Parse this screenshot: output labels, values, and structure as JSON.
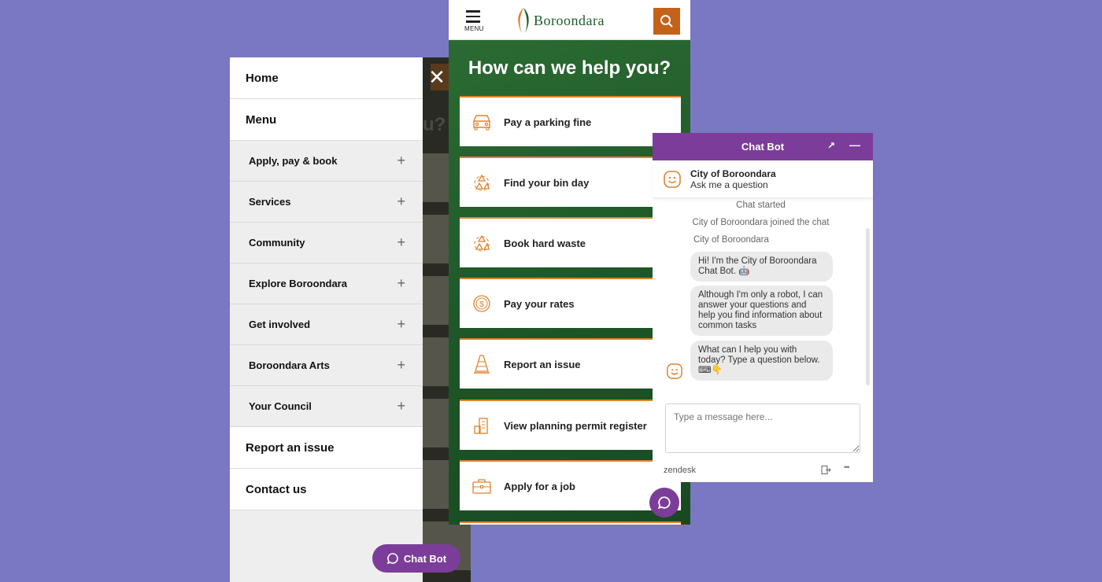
{
  "menu": {
    "top_items": [
      {
        "label": "Home"
      },
      {
        "label": "Menu"
      }
    ],
    "sub_items": [
      {
        "label": "Apply, pay & book"
      },
      {
        "label": "Services"
      },
      {
        "label": "Community"
      },
      {
        "label": "Explore Boroondara"
      },
      {
        "label": "Get involved"
      },
      {
        "label": "Boroondara Arts"
      },
      {
        "label": "Your Council"
      }
    ],
    "bottom_items": [
      {
        "label": "Report an issue"
      },
      {
        "label": "Contact us"
      }
    ],
    "plus_symbol": "+",
    "close_symbol": "✕",
    "chat_pill_label": "Chat Bot"
  },
  "header": {
    "menu_label": "MENU",
    "logo_text": "Boroondara"
  },
  "hero": {
    "title": "How can we help you?"
  },
  "cards": [
    {
      "label": "Pay a parking fine",
      "icon": "car-icon"
    },
    {
      "label": "Find your bin day",
      "icon": "recycle-icon"
    },
    {
      "label": "Book hard waste",
      "icon": "recycle-icon"
    },
    {
      "label": "Pay your rates",
      "icon": "dollar-coin-icon"
    },
    {
      "label": "Report an issue",
      "icon": "traffic-cone-icon"
    },
    {
      "label": "View planning permit register",
      "icon": "buildings-icon"
    },
    {
      "label": "Apply for a job",
      "icon": "briefcase-icon"
    }
  ],
  "chat": {
    "title": "Chat Bot",
    "agent_name": "City of Boroondara",
    "agent_sub": "Ask me a question",
    "sys_started": "Chat started",
    "sys_joined": "City of Boroondara joined the chat",
    "sender": "City of Boroondara",
    "messages": [
      "Hi! I'm the City of Boroondara Chat Bot. 🤖",
      "Although I'm only a robot, I can answer your questions and help you find information about common tasks",
      "What can I help you with today? Type a question below. ⌨👇"
    ],
    "input_placeholder": "Type a message here...",
    "footer_brand": "zendesk",
    "expand_symbol": "↗",
    "minimize_symbol": "—",
    "more_symbol": "•••"
  },
  "colors": {
    "background": "#7a78c2",
    "brand_purple": "#7b3d99",
    "brand_green": "#1f5a2a",
    "accent_orange": "#e0822c"
  }
}
